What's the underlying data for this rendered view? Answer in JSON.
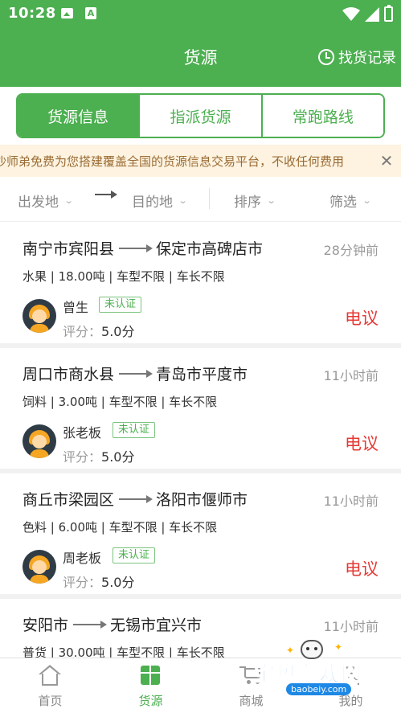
{
  "status_bar": {
    "time": "10:28",
    "a_badge": "A"
  },
  "header": {
    "title": "货源",
    "history_label": "找货记录",
    "history_icon": "clock-icon"
  },
  "tabs": [
    {
      "label": "货源信息",
      "active": true
    },
    {
      "label": "指派货源",
      "active": false
    },
    {
      "label": "常跑路线",
      "active": false
    }
  ],
  "notice": {
    "text": "：沙师弟免费为您搭建覆盖全国的货源信息交易平台，不收任何费用",
    "close_icon": "close-icon"
  },
  "filters": {
    "origin": "出发地",
    "destination": "目的地",
    "sort": "排序",
    "filter": "筛选"
  },
  "cargo_list": [
    {
      "from": "南宁市宾阳县",
      "to": "保定市高碑店市",
      "time": "28分钟前",
      "details": "水果 | 18.00吨 | 车型不限 | 车长不限",
      "name": "曾生",
      "badge": "未认证",
      "rating_label": "评分：",
      "rating": "5.0分",
      "price": "电议"
    },
    {
      "from": "周口市商水县",
      "to": "青岛市平度市",
      "time": "11小时前",
      "details": "饲料 | 3.00吨 | 车型不限 | 车长不限",
      "name": "张老板",
      "badge": "未认证",
      "rating_label": "评分：",
      "rating": "5.0分",
      "price": "电议"
    },
    {
      "from": "商丘市梁园区",
      "to": "洛阳市偃师市",
      "time": "11小时前",
      "details": "色料 | 6.00吨 | 车型不限 | 车长不限",
      "name": "周老板",
      "badge": "未认证",
      "rating_label": "评分：",
      "rating": "5.0分",
      "price": "电议"
    },
    {
      "from": "安阳市",
      "to": "无锡市宜兴市",
      "time": "11小时前",
      "details": "普货 | 30.00吨 | 车型不限 | 车长不限"
    }
  ],
  "bottom_nav": [
    {
      "label": "首页",
      "icon": "home-icon",
      "active": false
    },
    {
      "label": "货源",
      "icon": "box-icon",
      "active": true
    },
    {
      "label": "商城",
      "icon": "cart-icon",
      "active": false
    },
    {
      "label": "我的",
      "icon": "user-icon",
      "active": false
    }
  ],
  "watermark": {
    "text": "宝贝游戏网",
    "url": "baobeiy.com"
  },
  "colors": {
    "primary": "#4caf50",
    "accent_red": "#e53935",
    "notice_bg": "#fdf3e0",
    "notice_text": "#9a6b34"
  }
}
